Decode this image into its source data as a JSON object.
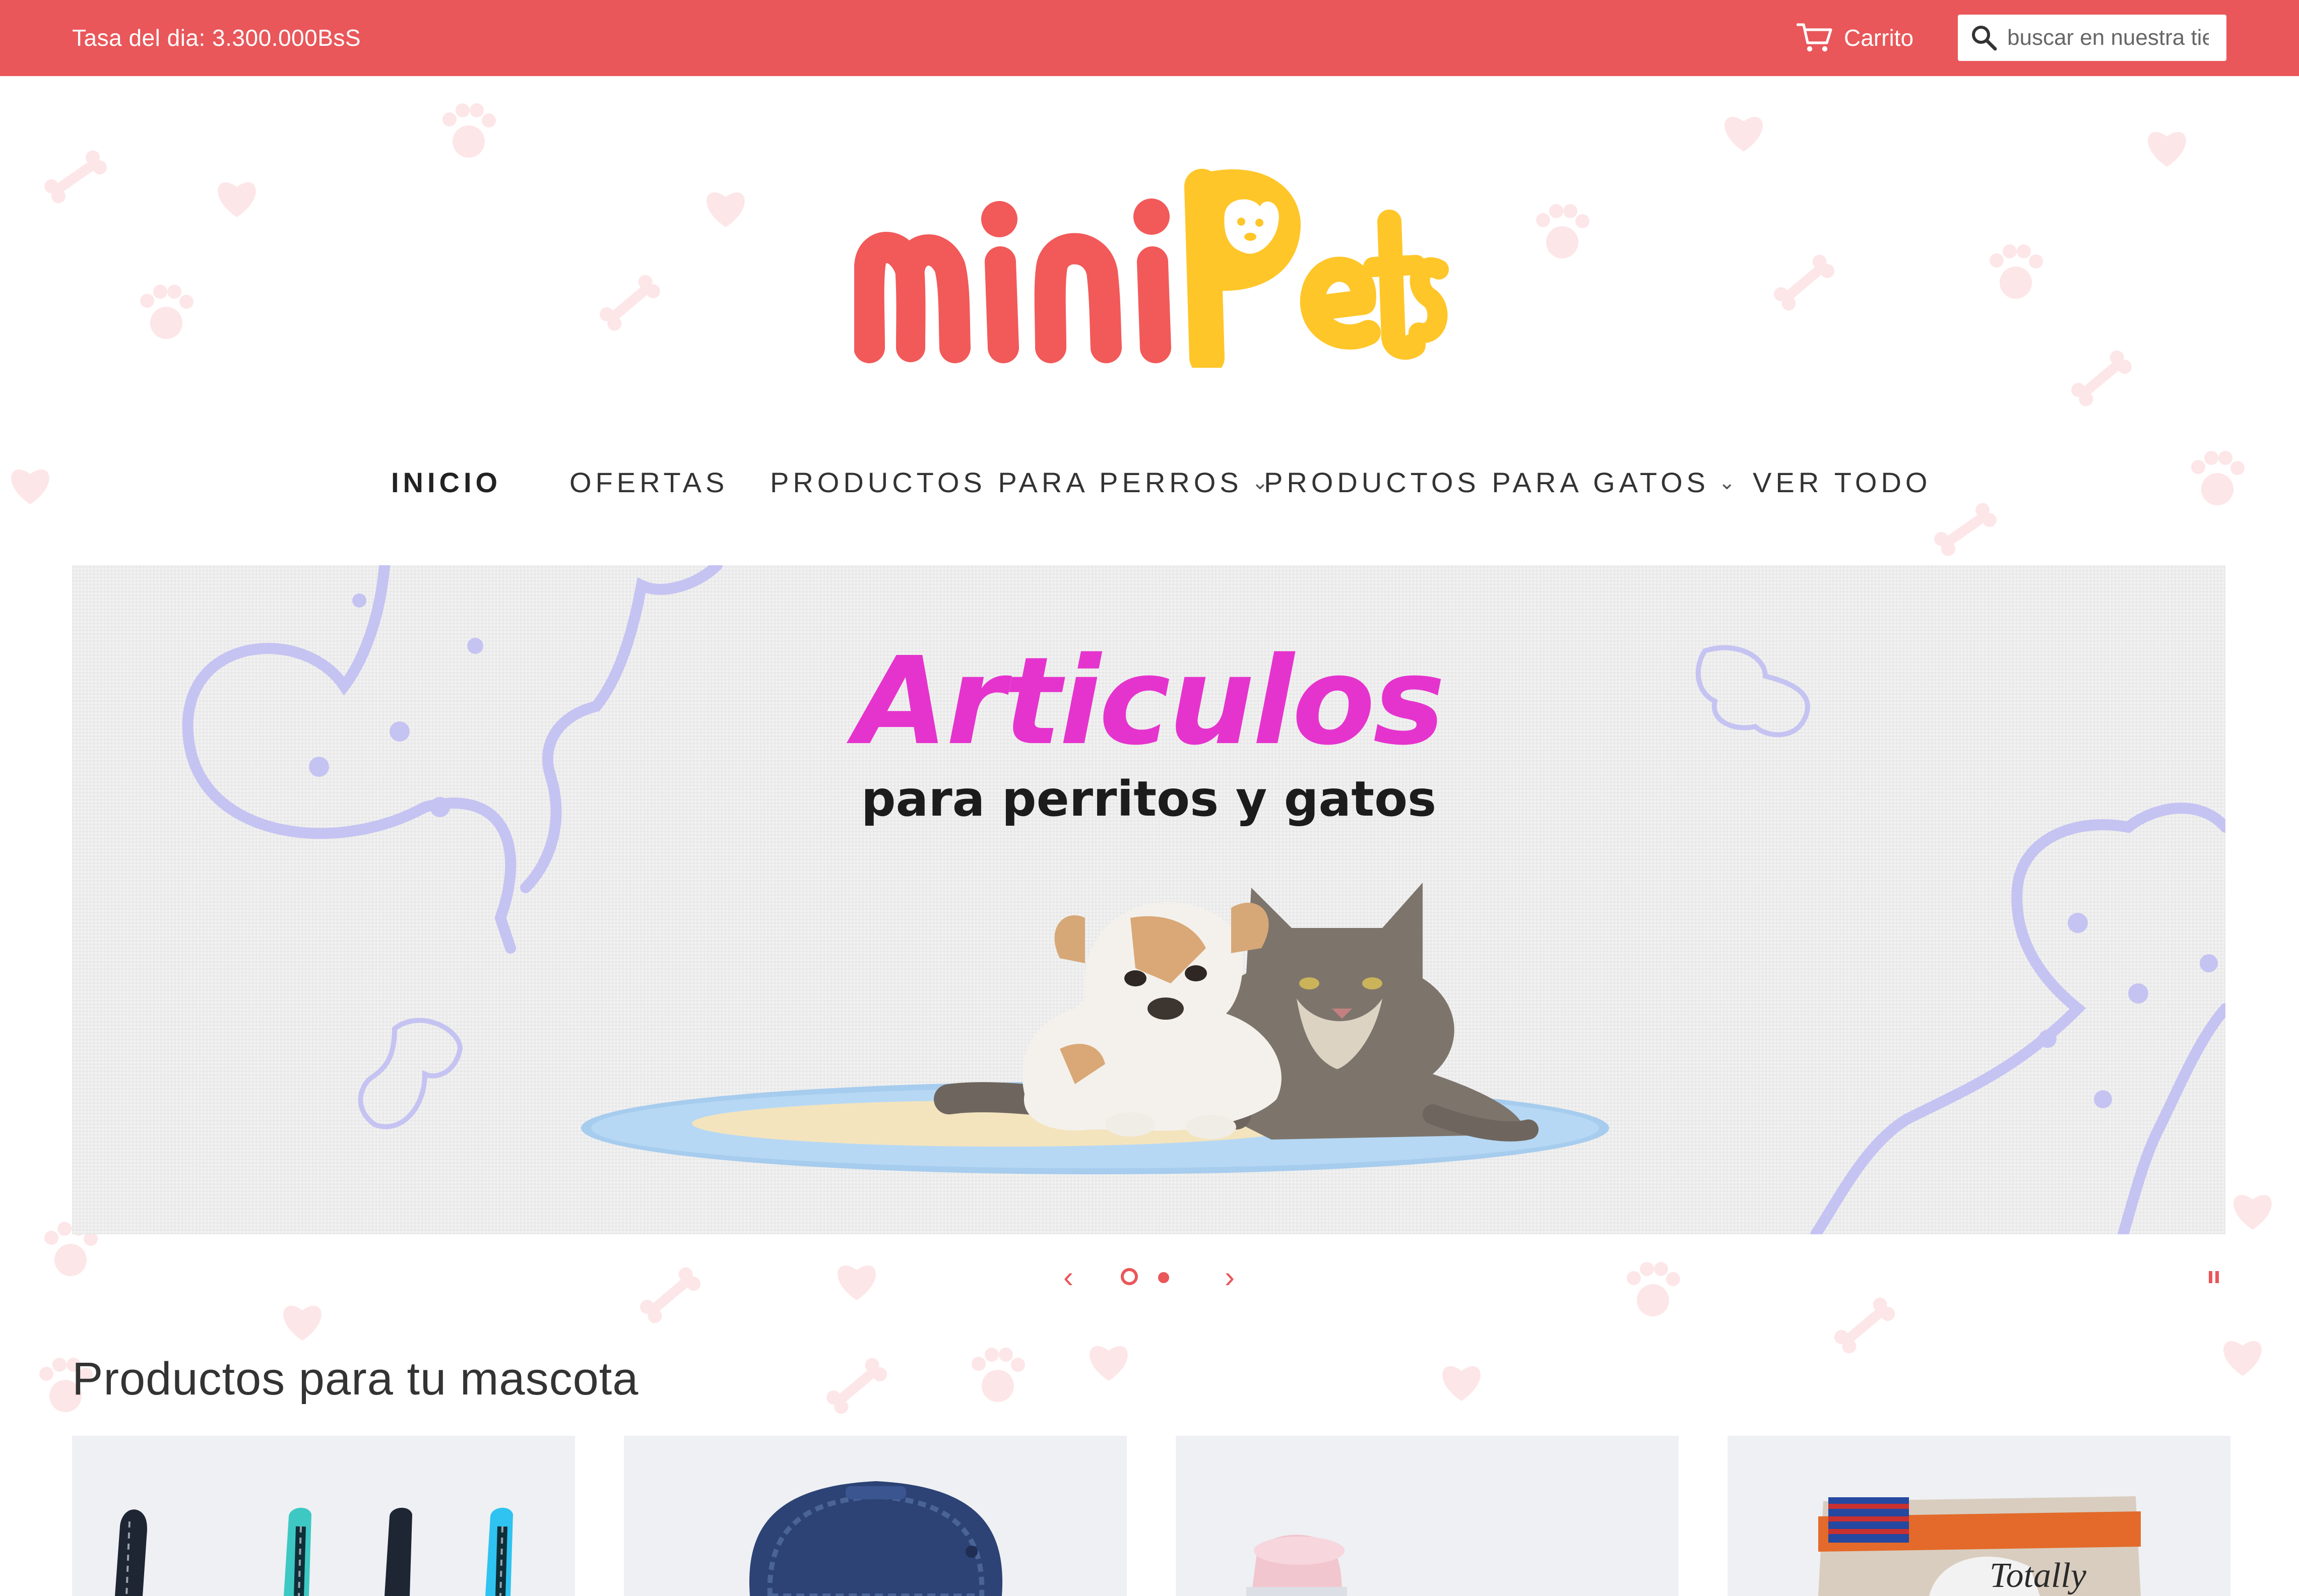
{
  "topbar": {
    "rate_text": "Tasa del dia: 3.300.000BsS",
    "cart_label": "Carrito",
    "search_placeholder": "buscar en nuestra tienda"
  },
  "logo": {
    "alt": "miniPets"
  },
  "nav": {
    "items": [
      {
        "label": "INICIO",
        "active": true
      },
      {
        "label": "OFERTAS"
      },
      {
        "label": "PRODUCTOS PARA PERROS",
        "dropdown": true
      },
      {
        "label": "PRODUCTOS PARA GATOS",
        "dropdown": true
      },
      {
        "label": "VER TODO"
      }
    ]
  },
  "hero": {
    "title": "Articulos",
    "subtitle": "para perritos y gatos",
    "slide_count": 2,
    "active_slide": 1
  },
  "products": {
    "title": "Productos para tu mascota",
    "items": [
      {
        "icon": "dog-leash-image"
      },
      {
        "icon": "backpack-carrier-image"
      },
      {
        "icon": "pet-bowl-image"
      },
      {
        "icon": "pet-treats-bag-image"
      }
    ]
  },
  "colors": {
    "accent": "#e9575a",
    "logo_red": "#f25959",
    "logo_yellow": "#ffc629",
    "hero_title": "#e534cd",
    "hero_bones": "#c5c3f2"
  }
}
